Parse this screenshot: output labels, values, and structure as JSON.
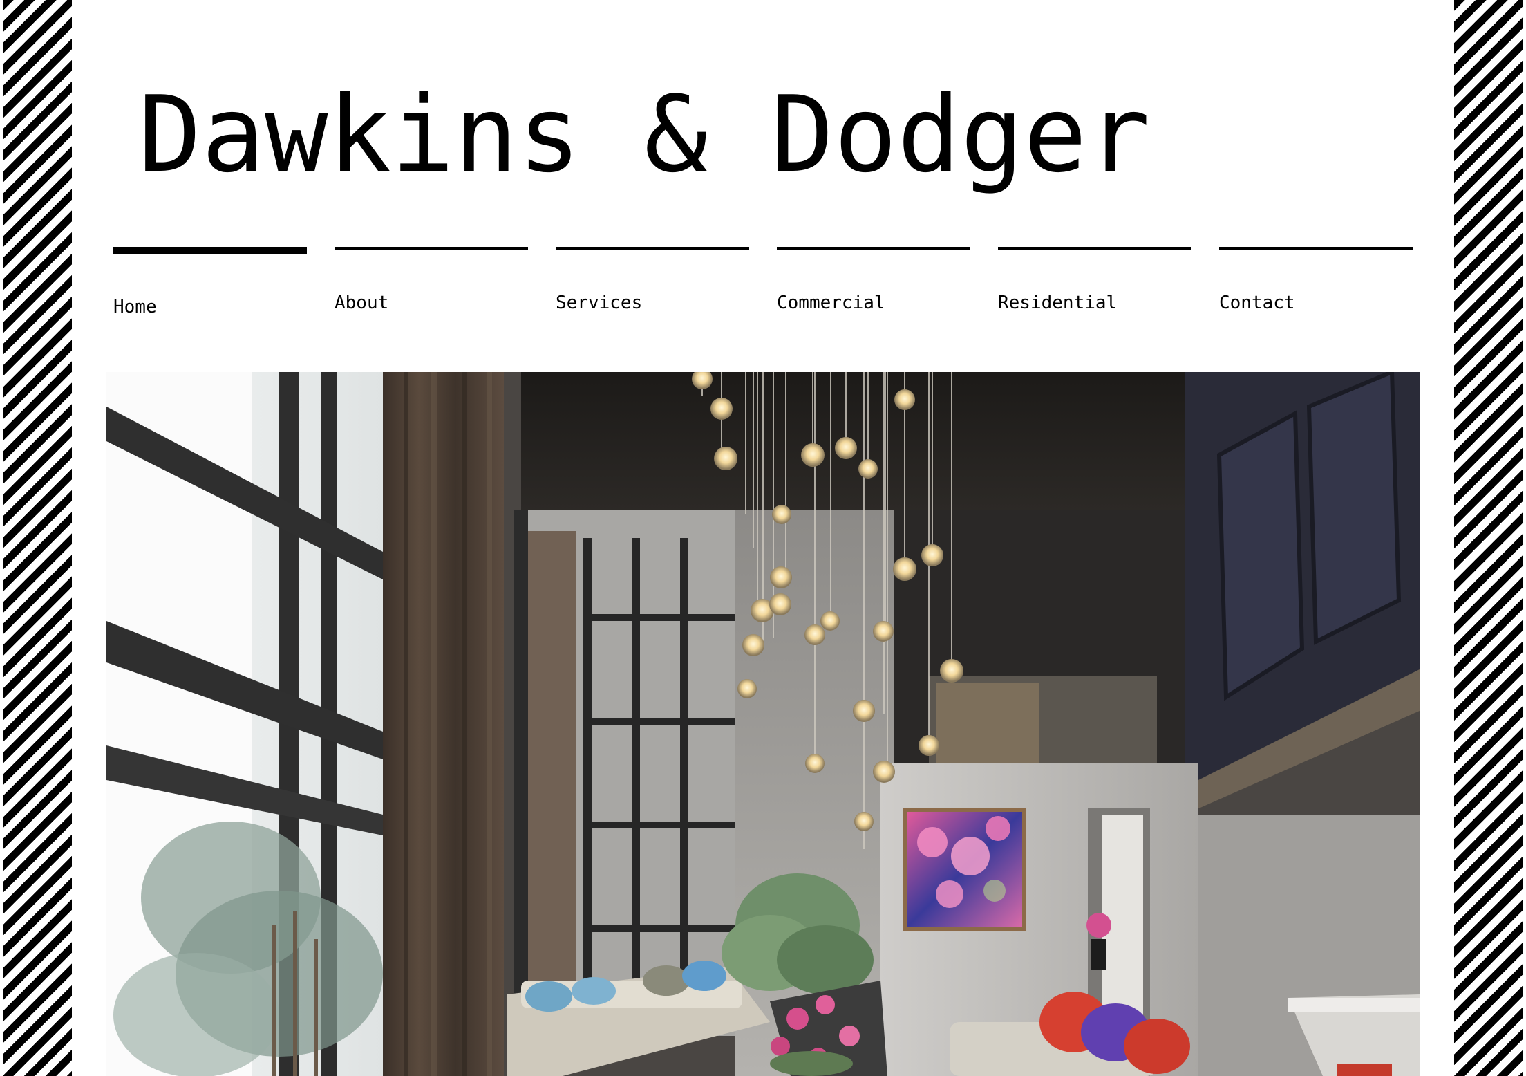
{
  "site": {
    "title": "Dawkins & Dodger"
  },
  "nav": {
    "items": [
      {
        "label": "Home",
        "active": true
      },
      {
        "label": "About",
        "active": false
      },
      {
        "label": "Services",
        "active": false
      },
      {
        "label": "Commercial",
        "active": false
      },
      {
        "label": "Residential",
        "active": false
      },
      {
        "label": "Contact",
        "active": false
      }
    ]
  },
  "colors": {
    "border_stripe_dark": "#000000",
    "border_stripe_light": "#ffffff",
    "text": "#000000",
    "background": "#ffffff"
  },
  "hero": {
    "image": "loft-living-room-with-pendant-lights"
  }
}
